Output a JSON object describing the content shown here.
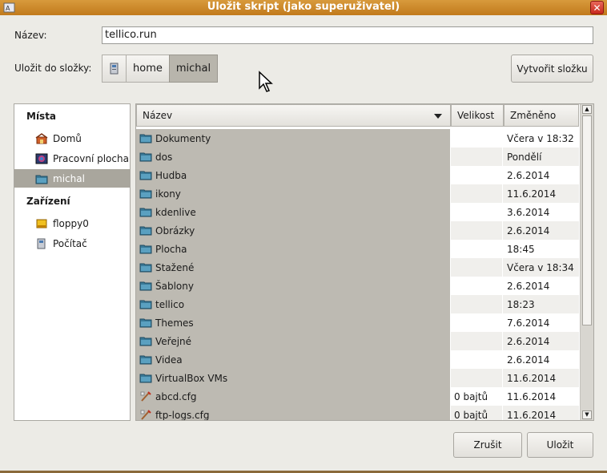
{
  "window": {
    "title": "Uložit skript (jako superuživatel)"
  },
  "name_field": {
    "label": "Název:",
    "value": "tellico.run"
  },
  "save_in": {
    "label": "Uložit do složky:",
    "path": [
      "home",
      "michal"
    ],
    "new_folder_label": "Vytvořit složku"
  },
  "places": {
    "header_places": "Místa",
    "header_devices": "Zařízení",
    "items": [
      {
        "label": "Domů",
        "icon": "home-icon"
      },
      {
        "label": "Pracovní plocha",
        "icon": "desktop-icon"
      },
      {
        "label": "michal",
        "icon": "folder-icon",
        "selected": true
      }
    ],
    "devices": [
      {
        "label": "floppy0",
        "icon": "floppy-icon"
      },
      {
        "label": "Počítač",
        "icon": "computer-icon"
      }
    ]
  },
  "columns": {
    "name": "Název",
    "size": "Velikost",
    "modified": "Změněno"
  },
  "files": [
    {
      "name": "Dokumenty",
      "size": "",
      "modified": "Včera v 18:32",
      "type": "folder"
    },
    {
      "name": "dos",
      "size": "",
      "modified": "Pondělí",
      "type": "folder"
    },
    {
      "name": "Hudba",
      "size": "",
      "modified": "2.6.2014",
      "type": "folder"
    },
    {
      "name": "ikony",
      "size": "",
      "modified": "11.6.2014",
      "type": "folder"
    },
    {
      "name": "kdenlive",
      "size": "",
      "modified": "3.6.2014",
      "type": "folder"
    },
    {
      "name": "Obrázky",
      "size": "",
      "modified": "2.6.2014",
      "type": "folder"
    },
    {
      "name": "Plocha",
      "size": "",
      "modified": "18:45",
      "type": "folder"
    },
    {
      "name": "Stažené",
      "size": "",
      "modified": "Včera v 18:34",
      "type": "folder"
    },
    {
      "name": "Šablony",
      "size": "",
      "modified": "2.6.2014",
      "type": "folder"
    },
    {
      "name": "tellico",
      "size": "",
      "modified": "18:23",
      "type": "folder"
    },
    {
      "name": "Themes",
      "size": "",
      "modified": "7.6.2014",
      "type": "folder"
    },
    {
      "name": "Veřejné",
      "size": "",
      "modified": "2.6.2014",
      "type": "folder"
    },
    {
      "name": "Videa",
      "size": "",
      "modified": "2.6.2014",
      "type": "folder"
    },
    {
      "name": "VirtualBox VMs",
      "size": "",
      "modified": "11.6.2014",
      "type": "folder"
    },
    {
      "name": "abcd.cfg",
      "size": "0 bajtů",
      "modified": "11.6.2014",
      "type": "file"
    },
    {
      "name": "ftp-logs.cfg",
      "size": "0 bajtů",
      "modified": "11.6.2014",
      "type": "file"
    }
  ],
  "buttons": {
    "cancel": "Zrušit",
    "save": "Uložit"
  },
  "colors": {
    "titlebar": "#c98a2c",
    "selection": "#a9a69d",
    "name_column": "#bdbab2",
    "folder": "#3a7a98"
  }
}
